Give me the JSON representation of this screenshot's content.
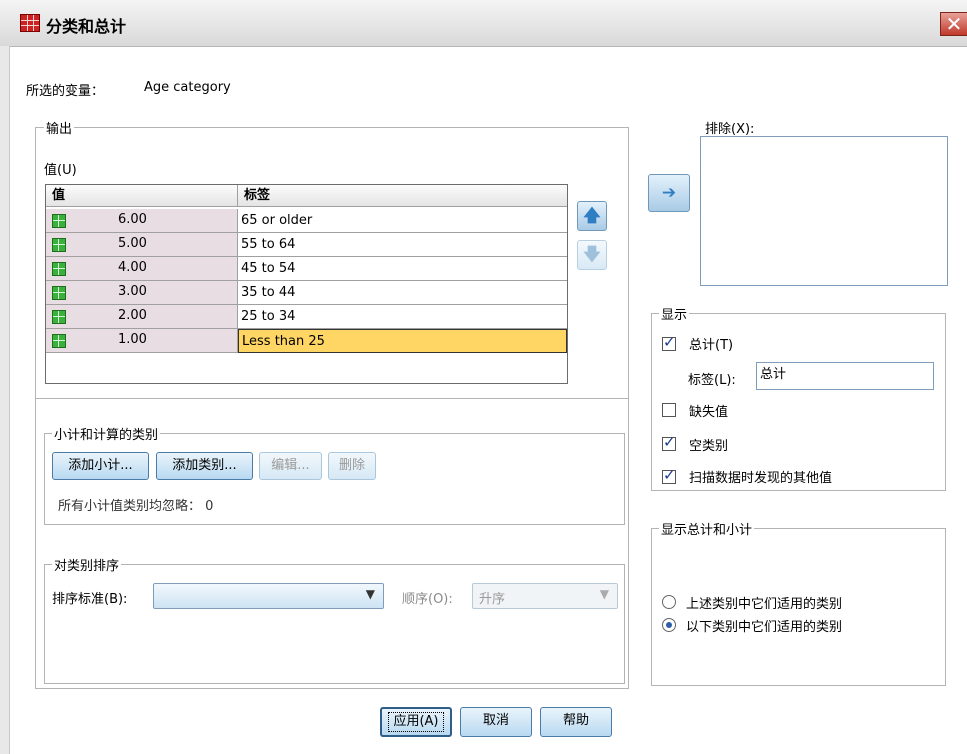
{
  "window": {
    "title": "分类和总计",
    "close_glyph": "✕"
  },
  "selected_variable": {
    "label": "所选的变量：",
    "value": "Age category"
  },
  "output_group": {
    "label": "输出",
    "values_label": "值(U)",
    "table": {
      "headers": [
        "值",
        "标签"
      ],
      "rows": [
        {
          "value": "6.00",
          "label": "65 or older"
        },
        {
          "value": "5.00",
          "label": "55 to 64"
        },
        {
          "value": "4.00",
          "label": "45 to 54"
        },
        {
          "value": "3.00",
          "label": "35 to 44"
        },
        {
          "value": "2.00",
          "label": "25 to 34"
        },
        {
          "value": "1.00",
          "label": "Less than 25"
        }
      ]
    },
    "move_up_glyph": "🡅",
    "move_down_glyph": "🡇"
  },
  "exclude": {
    "label": "排除(X):",
    "move_glyph": "➔"
  },
  "subtotals": {
    "label": "小计和计算的类别",
    "add_subtotal": "添加小计...",
    "add_category": "添加类别...",
    "edit": "编辑...",
    "delete": "删除",
    "ignored_text": "所有小计值类别均忽略：  0"
  },
  "sort": {
    "label": "对类别排序",
    "sort_by_label": "排序标准(B):",
    "sort_by_value": "",
    "order_label": "顺序(O):",
    "order_value": "升序"
  },
  "show": {
    "label": "显示",
    "total": "总计(T)",
    "total_checked": true,
    "label_field_label": "标签(L):",
    "label_field_value": "总计",
    "missing": "缺失值",
    "missing_checked": false,
    "empty": "空类别",
    "empty_checked": true,
    "other": "扫描数据时发现的其他值",
    "other_checked": true
  },
  "position": {
    "label": "显示总计和小计",
    "above": "上述类别中它们适用的类别",
    "below": "以下类别中它们适用的类别",
    "selected": "below"
  },
  "footer": {
    "apply": "应用(A)",
    "cancel": "取消",
    "help": "帮助"
  },
  "colors": {
    "accent": "#2f7dc3",
    "selected_row": "#ffd563",
    "value_cell": "#e8dde2",
    "title_icon": "#cc2222"
  },
  "icons": {
    "app": "table-icon",
    "row": "grid-icon"
  }
}
